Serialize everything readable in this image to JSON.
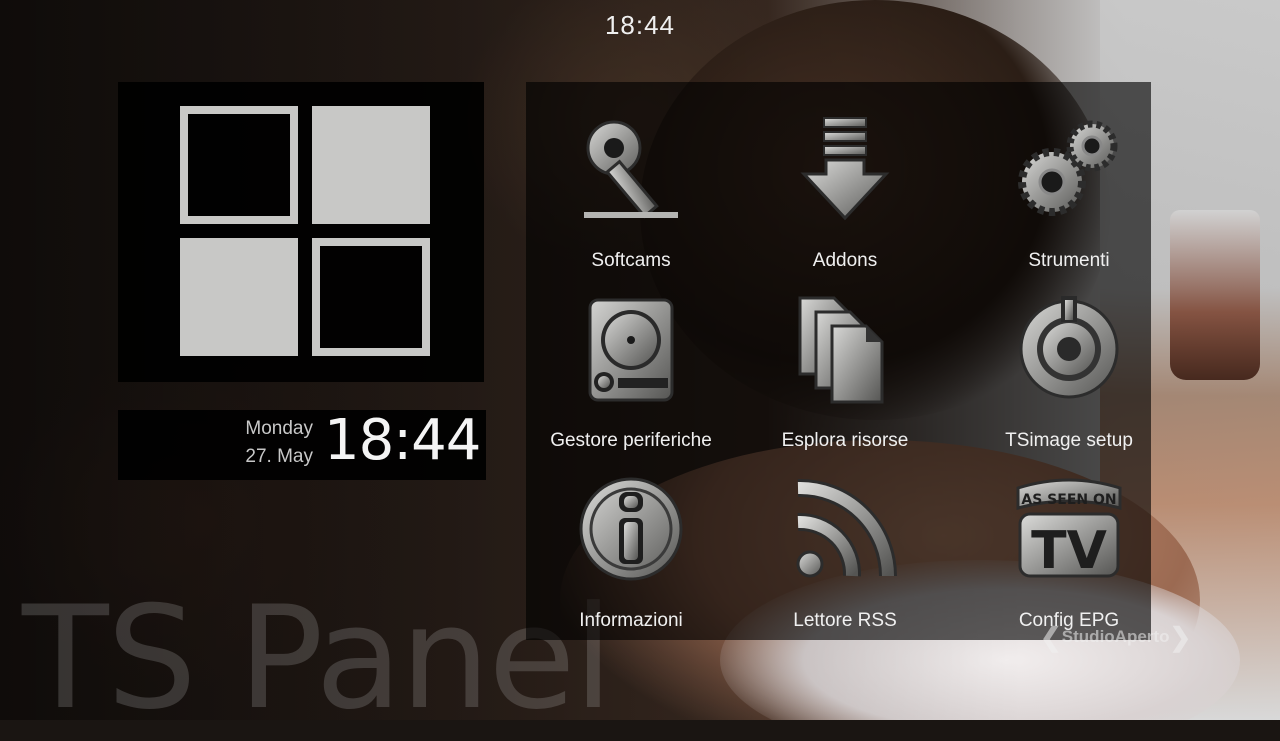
{
  "status": {
    "clock": "18:44"
  },
  "date_widget": {
    "day": "Monday",
    "date": "27. May",
    "time": "18:44"
  },
  "watermark": {
    "title": "TS Panel"
  },
  "channel_logo": {
    "text": "StudioAperto",
    "left": "❮",
    "right": "❯"
  },
  "panel": {
    "items": [
      {
        "label": "Softcams",
        "icon": "key-icon"
      },
      {
        "label": "Addons",
        "icon": "download-arrow-icon"
      },
      {
        "label": "Strumenti",
        "icon": "gears-icon"
      },
      {
        "label": "Gestore periferiche",
        "icon": "hard-disk-icon"
      },
      {
        "label": "Esplora risorse",
        "icon": "files-icon"
      },
      {
        "label": "TSimage setup",
        "icon": "power-dial-icon"
      },
      {
        "label": "Informazioni",
        "icon": "info-icon"
      },
      {
        "label": "Lettore RSS",
        "icon": "rss-icon"
      },
      {
        "label": "Config EPG",
        "icon": "as-seen-on-tv-icon"
      }
    ]
  },
  "colors": {
    "metal": "#9a9a98",
    "tile": "#c8c8c6",
    "panel_bg": "#000000"
  }
}
